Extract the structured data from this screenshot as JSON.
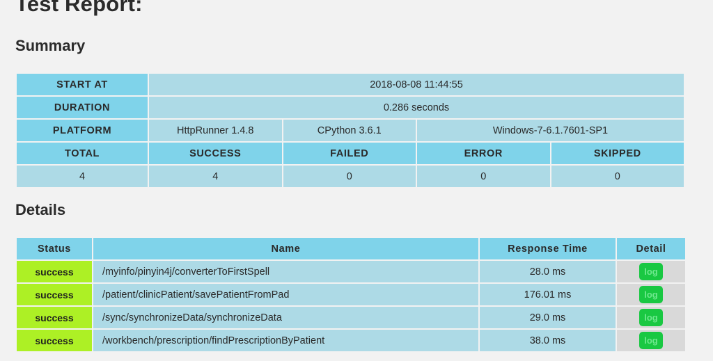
{
  "page": {
    "title": "Test Report:",
    "background_color": "#f2f2f2",
    "header_cell_color": "#7fd3ea",
    "data_cell_color": "#addae6",
    "success_color": "#adf025",
    "log_button_color": "#19c842"
  },
  "summary": {
    "heading": "Summary",
    "rows": {
      "start_at": {
        "label": "START AT",
        "value": "2018-08-08 11:44:55"
      },
      "duration": {
        "label": "DURATION",
        "value": "0.286 seconds"
      },
      "platform": {
        "label": "PLATFORM",
        "runner": "HttpRunner 1.4.8",
        "interpreter": "CPython 3.6.1",
        "os": "Windows-7-6.1.7601-SP1"
      },
      "stat_headers": {
        "total": "TOTAL",
        "success": "SUCCESS",
        "failed": "FAILED",
        "error": "ERROR",
        "skipped": "SKIPPED"
      },
      "stat_values": {
        "total": "4",
        "success": "4",
        "failed": "0",
        "error": "0",
        "skipped": "0"
      }
    }
  },
  "details": {
    "heading": "Details",
    "columns": {
      "status": "Status",
      "name": "Name",
      "response_time": "Response Time",
      "detail": "Detail"
    },
    "rows": [
      {
        "status": "success",
        "name": "/myinfo/pinyin4j/converterToFirstSpell",
        "response_time": "28.0 ms",
        "detail_label": "log"
      },
      {
        "status": "success",
        "name": "/patient/clinicPatient/savePatientFromPad",
        "response_time": "176.01 ms",
        "detail_label": "log"
      },
      {
        "status": "success",
        "name": "/sync/synchronizeData/synchronizeData",
        "response_time": "29.0 ms",
        "detail_label": "log"
      },
      {
        "status": "success",
        "name": "/workbench/prescription/findPrescriptionByPatient",
        "response_time": "38.0 ms",
        "detail_label": "log"
      }
    ]
  }
}
